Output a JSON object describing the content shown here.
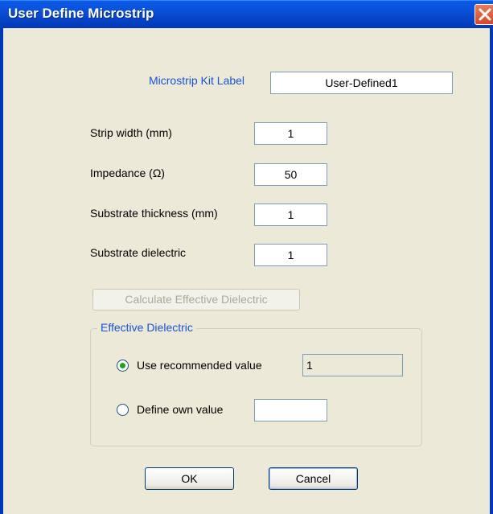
{
  "window": {
    "title": "User Define Microstrip",
    "close_icon": "close-icon"
  },
  "kit_label": {
    "label": "Microstrip Kit Label",
    "value": "User-Defined1"
  },
  "fields": [
    {
      "label": "Strip width (mm)",
      "value": "1"
    },
    {
      "label": "Impedance (Ω)",
      "value": "50"
    },
    {
      "label": "Substrate thickness (mm)",
      "value": "1"
    },
    {
      "label": "Substrate dielectric",
      "value": "1"
    }
  ],
  "calculate_button": {
    "label": "Calculate Effective Dielectric",
    "enabled": false
  },
  "effective_dielectric": {
    "legend": "Effective Dielectric",
    "options": [
      {
        "label": "Use recommended value",
        "selected": true,
        "value": "1"
      },
      {
        "label": "Define own value",
        "selected": false,
        "value": ""
      }
    ]
  },
  "buttons": {
    "ok": "OK",
    "cancel": "Cancel"
  },
  "colors": {
    "title_bar": "#0a4fd6",
    "dialog_bg": "#ece9d8",
    "accent_label": "#1754d6",
    "radio_dot": "#21a121"
  }
}
